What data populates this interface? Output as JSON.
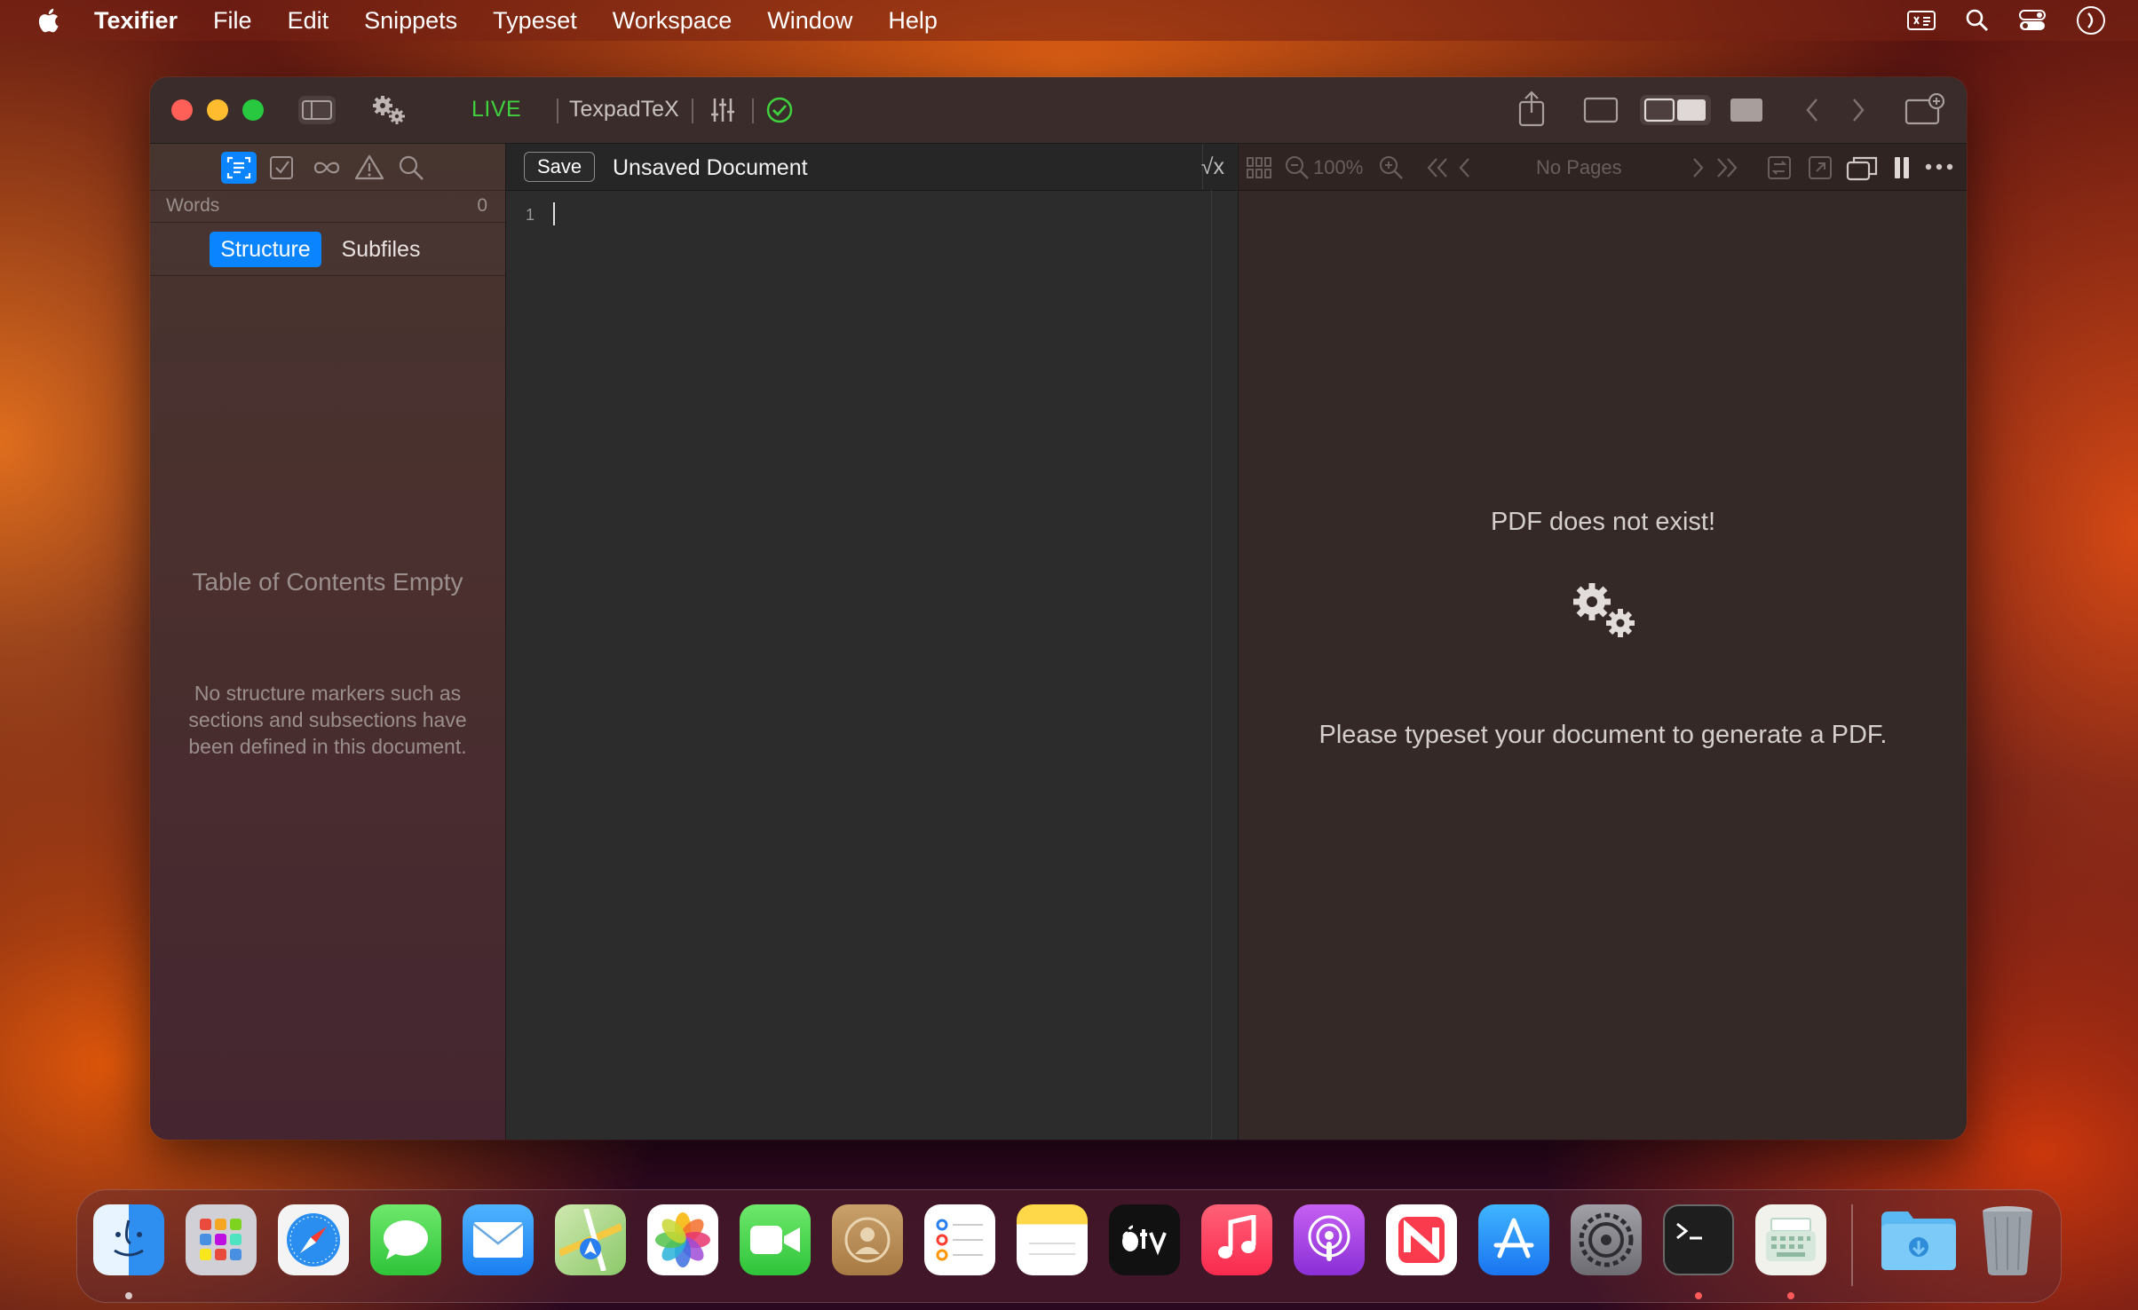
{
  "menubar": {
    "app_name": "Texifier",
    "items": [
      "File",
      "Edit",
      "Snippets",
      "Typeset",
      "Workspace",
      "Window",
      "Help"
    ],
    "right_icons": [
      "input-menu-icon",
      "spotlight-search-icon",
      "control-center-icon",
      "siri-icon"
    ]
  },
  "toolbar": {
    "live_label": "LIVE",
    "engine_label": "TexpadTeX"
  },
  "sidebar": {
    "words_label": "Words",
    "words_count": "0",
    "tabs": [
      "Structure",
      "Subfiles"
    ],
    "active_tab": "Structure",
    "toc_title": "Table of Contents Empty",
    "toc_desc": "No structure markers such as sections and subsections have been defined in this document."
  },
  "editor": {
    "save_label": "Save",
    "doc_title": "Unsaved Document",
    "sqrt_label": "√x",
    "line_number": "1"
  },
  "preview": {
    "zoom_label": "100%",
    "pages_label": "No Pages",
    "error_title": "PDF does not exist!",
    "error_hint": "Please typeset your document to generate a PDF."
  },
  "dock": {
    "apps": [
      "Finder",
      "Launchpad",
      "Safari",
      "Messages",
      "Mail",
      "Maps",
      "Photos",
      "FaceTime",
      "Contacts",
      "Reminders",
      "Notes",
      "Apple TV",
      "Music",
      "Podcasts",
      "News",
      "App Store",
      "System Settings",
      "Terminal",
      "Texifier",
      "Downloads",
      "Trash"
    ]
  },
  "colors": {
    "accent": "#0a84ff",
    "live_green": "#3ed23e",
    "traffic_red": "#fe5f57",
    "traffic_yellow": "#febc2e",
    "traffic_green": "#28c840"
  }
}
